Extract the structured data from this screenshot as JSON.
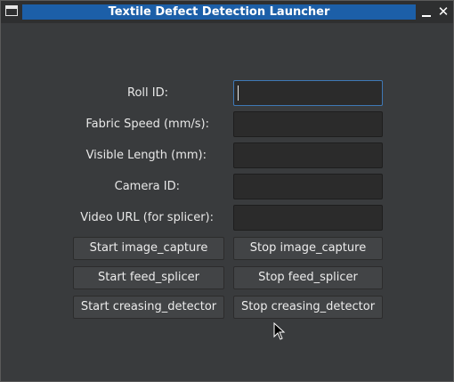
{
  "window": {
    "title": "Textile Defect Detection Launcher",
    "minimize_glyph": "",
    "close_glyph": "✕"
  },
  "form": {
    "roll_id": {
      "label": "Roll ID:",
      "value": ""
    },
    "fabric_speed": {
      "label": "Fabric Speed (mm/s):",
      "value": ""
    },
    "visible_length": {
      "label": "Visible Length (mm):",
      "value": ""
    },
    "camera_id": {
      "label": "Camera ID:",
      "value": ""
    },
    "video_url": {
      "label": "Video URL (for splicer):",
      "value": ""
    }
  },
  "buttons": {
    "start_image_capture": "Start image_capture",
    "stop_image_capture": "Stop image_capture",
    "start_feed_splicer": "Start feed_splicer",
    "stop_feed_splicer": "Stop feed_splicer",
    "start_creasing_detector": "Start creasing_detector",
    "stop_creasing_detector": "Stop creasing_detector"
  },
  "colors": {
    "title_accent": "#1c5fa8",
    "window_bg": "#393b3d",
    "field_bg": "#2b2b2b",
    "focus_border": "#3f78b5"
  }
}
